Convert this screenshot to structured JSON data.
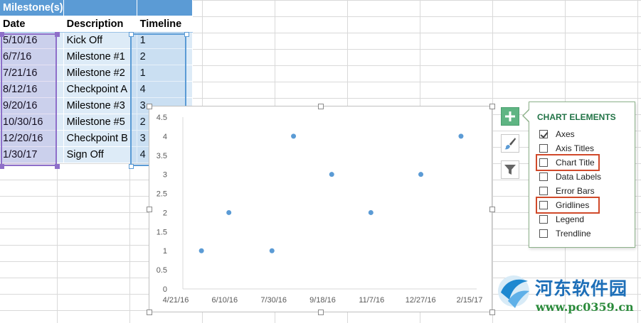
{
  "table": {
    "title": "Milestone(s)",
    "headers": [
      "Date",
      "Description",
      "Timeline"
    ],
    "rows": [
      [
        "5/10/16",
        "Kick Off",
        "1"
      ],
      [
        "6/7/16",
        "Milestone #1",
        "2"
      ],
      [
        "7/21/16",
        "Milestone #2",
        "1"
      ],
      [
        "8/12/16",
        "Checkpoint A",
        "4"
      ],
      [
        "9/20/16",
        "Milestone #3",
        "3"
      ],
      [
        "10/30/16",
        "Milestone #5",
        "2"
      ],
      [
        "12/20/16",
        "Checkpoint B",
        "3"
      ],
      [
        "1/30/17",
        "Sign Off",
        "4"
      ]
    ]
  },
  "chart_data": {
    "type": "scatter",
    "title": "",
    "xlabel": "",
    "ylabel": "",
    "x_ticks": [
      "4/21/16",
      "6/10/16",
      "7/30/16",
      "9/18/16",
      "11/7/16",
      "12/27/16",
      "2/15/17"
    ],
    "y_ticks": [
      "0",
      "0.5",
      "1",
      "1.5",
      "2",
      "2.5",
      "3",
      "3.5",
      "4",
      "4.5"
    ],
    "xlim": [
      "2016-04-21",
      "2017-02-15"
    ],
    "ylim": [
      0,
      4.5
    ],
    "grid": false,
    "points": [
      {
        "x": "2016-05-10",
        "y": 1
      },
      {
        "x": "2016-06-07",
        "y": 2
      },
      {
        "x": "2016-07-21",
        "y": 1
      },
      {
        "x": "2016-08-12",
        "y": 4
      },
      {
        "x": "2016-09-20",
        "y": 3
      },
      {
        "x": "2016-10-30",
        "y": 2
      },
      {
        "x": "2016-12-20",
        "y": 3
      },
      {
        "x": "2017-01-30",
        "y": 4
      }
    ],
    "marker_color": "#5b9bd5"
  },
  "chart_elements": {
    "title": "CHART ELEMENTS",
    "items": [
      {
        "label": "Axes",
        "checked": true
      },
      {
        "label": "Axis Titles",
        "checked": false
      },
      {
        "label": "Chart Title",
        "checked": false
      },
      {
        "label": "Data Labels",
        "checked": false
      },
      {
        "label": "Error Bars",
        "checked": false
      },
      {
        "label": "Gridlines",
        "checked": false
      },
      {
        "label": "Legend",
        "checked": false
      },
      {
        "label": "Trendline",
        "checked": false
      }
    ]
  },
  "side_buttons": {
    "plus_icon": "plus-icon",
    "styles_icon": "paintbrush-icon",
    "filter_icon": "filter-icon"
  },
  "watermark": {
    "text": "河东软件园",
    "url": "www.pc0359.cn"
  },
  "colors": {
    "header_blue": "#5b9bd5",
    "band": "#ddebf7",
    "highlight": "#d0492a",
    "accent_green": "#217346"
  }
}
